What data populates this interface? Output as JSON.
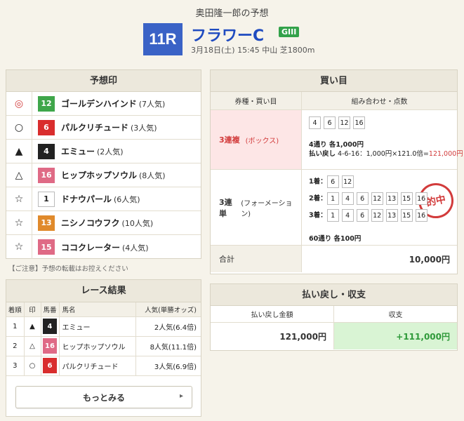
{
  "header": {
    "title": "奥田隆一郎の予想",
    "race_number": "11R",
    "race_name": "フラワーC",
    "grade": "GIII",
    "info": "3月18日(土) 15:45 中山 芝1800m"
  },
  "prediction": {
    "title": "予想印",
    "items": [
      {
        "mark": "◎",
        "num": "12",
        "name": "ゴールデンハインド",
        "pop": "(7人気)",
        "color": "green"
      },
      {
        "mark": "○",
        "num": "6",
        "name": "パルクリチュード",
        "pop": "(3人気)",
        "color": "red"
      },
      {
        "mark": "▲",
        "num": "4",
        "name": "エミュー",
        "pop": "(2人気)",
        "color": "black"
      },
      {
        "mark": "△",
        "num": "16",
        "name": "ヒップホップソウル",
        "pop": "(8人気)",
        "color": "pink"
      },
      {
        "mark": "☆",
        "num": "1",
        "name": "ドナウパール",
        "pop": "(6人気)",
        "color": "white"
      },
      {
        "mark": "☆",
        "num": "13",
        "name": "ニシノコウフク",
        "pop": "(10人気)",
        "color": "orange"
      },
      {
        "mark": "☆",
        "num": "15",
        "name": "ココクレーター",
        "pop": "(4人気)",
        "color": "pink"
      }
    ],
    "notice": "【ご注意】予想の転載はお控えください"
  },
  "results": {
    "title": "レース結果",
    "headers": [
      "着順",
      "印",
      "馬番",
      "馬名",
      "人気(単勝オッズ)"
    ],
    "rows": [
      {
        "rank": "1",
        "mark": "▲",
        "num": "4",
        "name": "エミュー",
        "pop": "2人気(6.4倍)",
        "color": "black"
      },
      {
        "rank": "2",
        "mark": "△",
        "num": "16",
        "name": "ヒップホップソウル",
        "pop": "8人気(11.1倍)",
        "color": "pink"
      },
      {
        "rank": "3",
        "mark": "○",
        "num": "6",
        "name": "パルクリチュード",
        "pop": "3人気(6.9倍)",
        "color": "red"
      }
    ],
    "more_label": "もっとみる"
  },
  "buy": {
    "title": "買い目",
    "col_type": "券種・買い目",
    "col_combo": "組み合わせ・点数",
    "bet1": {
      "type": "3連複",
      "method": "(ボックス)",
      "nums": [
        "4",
        "6",
        "12",
        "16"
      ],
      "count": "4通り 各1,000円",
      "payout_label": "払い戻し",
      "payout_detail": "4-6-16：1,000円×121.0倍=",
      "payout_amount": "121,000円",
      "stamp": "的中"
    },
    "bet2": {
      "type": "3連単",
      "method": "(フォーメーション)",
      "row1_label": "1着：",
      "row1_nums": [
        "6",
        "12"
      ],
      "row2_label": "2着：",
      "row2_nums": [
        "1",
        "4",
        "6",
        "12",
        "13",
        "15",
        "16"
      ],
      "row3_label": "3着：",
      "row3_nums": [
        "1",
        "4",
        "6",
        "12",
        "13",
        "15",
        "16"
      ],
      "count": "60通り 各100円"
    },
    "total_label": "合計",
    "total_value": "10,000円"
  },
  "payout": {
    "title": "払い戻し・収支",
    "col_amount": "払い戻し金額",
    "col_balance": "収支",
    "amount": "121,000円",
    "balance": "+111,000円"
  }
}
